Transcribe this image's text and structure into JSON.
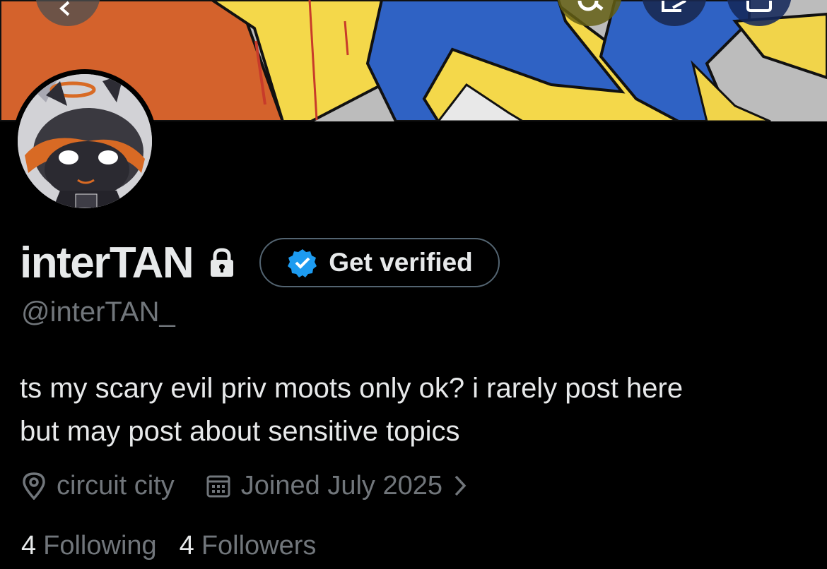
{
  "profile": {
    "display_name": "interTAN",
    "handle": "@interTAN_",
    "verify_label": "Get verified",
    "bio_line1": "ts my scary evil priv moots only ok? i rarely post here",
    "bio_line2": "but may post about sensitive topics",
    "location": "circuit city",
    "joined": "Joined July 2025",
    "following_count": "4",
    "following_label": "Following",
    "followers_count": "4",
    "followers_label": "Followers"
  },
  "icons": {
    "back": "back-arrow-icon",
    "search": "search-icon",
    "compose": "compose-icon",
    "more": "more-icon",
    "lock": "lock-icon",
    "verified": "verified-badge-icon",
    "location": "location-pin-icon",
    "calendar": "calendar-icon",
    "chevron": "chevron-right-icon"
  },
  "colors": {
    "background": "#000000",
    "primary_text": "#e7e9ea",
    "secondary_text": "#71767b",
    "verified_blue": "#1d9bf0",
    "button_border": "#536471"
  }
}
